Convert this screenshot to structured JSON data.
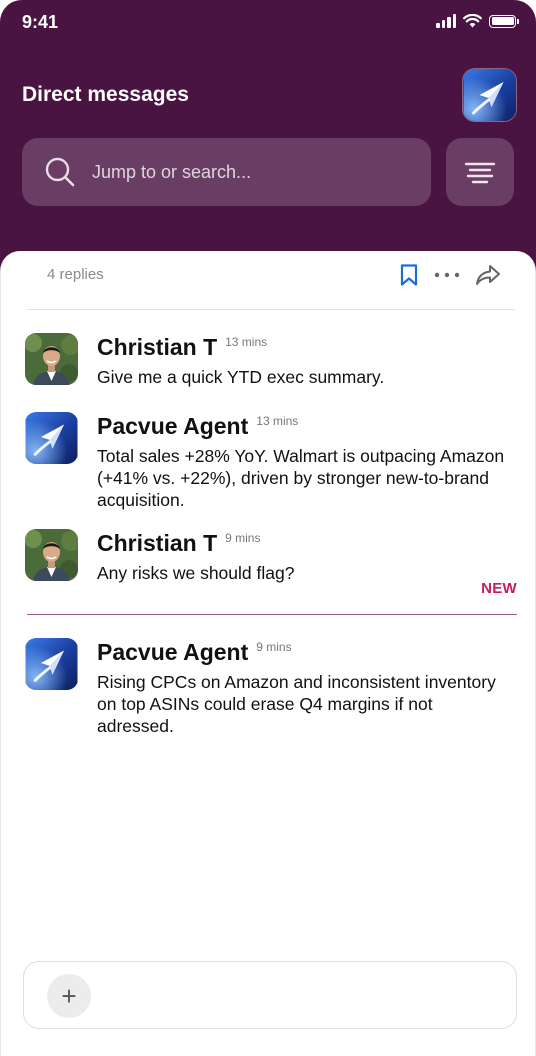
{
  "status_bar": {
    "time": "9:41"
  },
  "header": {
    "title": "Direct messages"
  },
  "search": {
    "placeholder": "Jump to or search..."
  },
  "thread": {
    "replies": "4 replies",
    "new_label": "NEW"
  },
  "messages": [
    {
      "author": "Christian T",
      "time": "13 mins",
      "text": "Give me a quick YTD exec summary."
    },
    {
      "author": "Pacvue Agent",
      "time": "13 mins",
      "text": "Total sales +28% YoY. Walmart is outpacing Amazon (+41% vs. +22%), driven by stronger new-to-brand acquisition."
    },
    {
      "author": "Christian T",
      "time": "9 mins",
      "text": "Any risks we should flag?"
    },
    {
      "author": "Pacvue Agent",
      "time": "9 mins",
      "text": "Rising CPCs on Amazon and inconsistent inventory on top ASINs could erase Q4 margins if not adressed."
    }
  ],
  "composer": {
    "plus_icon": "+"
  },
  "icons": [
    "search-icon",
    "filter-icon",
    "bookmark-icon",
    "more-icon",
    "share-icon",
    "plus-icon",
    "agent-logo-icon"
  ],
  "colors": {
    "header_bg": "#4a1442",
    "accent_new": "#c51d63",
    "bookmark": "#1a6fd0"
  }
}
